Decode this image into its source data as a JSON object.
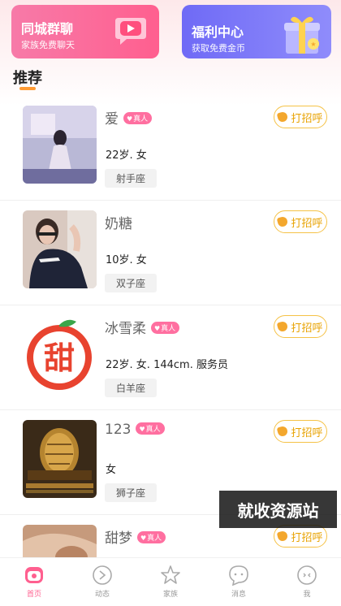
{
  "banners": {
    "left": {
      "title": "同城群聊",
      "subtitle": "家族免费聊天",
      "icon": "chat-bubble-icon",
      "color": "#ff5f8f"
    },
    "right": {
      "title": "福利中心",
      "subtitle": "获取免费金币",
      "icon": "gift-box-icon",
      "color": "#6f6af6"
    }
  },
  "section": {
    "title": "推荐",
    "accent": "#ff9b33"
  },
  "greet_label": "打招呼",
  "badge_label": "真人",
  "cards": [
    {
      "name": "爱",
      "verified": true,
      "info": "22岁. 女",
      "tag": "射手座",
      "avatar": "photo"
    },
    {
      "name": "奶糖",
      "verified": false,
      "info": "10岁. 女",
      "tag": "双子座",
      "avatar": "photo"
    },
    {
      "name": "冰雪柔",
      "verified": true,
      "info": "22岁. 女. 144cm. 服务员",
      "tag": "白羊座",
      "avatar": "tian-logo"
    },
    {
      "name": "123",
      "verified": true,
      "info": "女",
      "tag": "狮子座",
      "avatar": "game-poster"
    },
    {
      "name": "甜梦",
      "verified": true,
      "info": "",
      "tag": "",
      "avatar": "photo"
    }
  ],
  "tian_logo_text": "甜",
  "watermark": "就收资源站",
  "tabbar": [
    {
      "label": "首页",
      "icon": "home-icon",
      "active": true
    },
    {
      "label": "动态",
      "icon": "compass-icon",
      "active": false
    },
    {
      "label": "家族",
      "icon": "star-icon",
      "active": false
    },
    {
      "label": "消息",
      "icon": "message-icon",
      "active": false
    },
    {
      "label": "我",
      "icon": "profile-icon",
      "active": false
    }
  ]
}
